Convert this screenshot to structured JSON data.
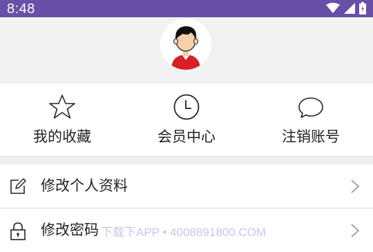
{
  "status_bar": {
    "time": "8:48",
    "icons": [
      "wifi-icon",
      "signal-icon",
      "battery-icon"
    ],
    "background": "#6a4fa8"
  },
  "profile": {
    "avatar_icon": "user-avatar-icon"
  },
  "quick_actions": [
    {
      "label": "我的收藏",
      "icon": "star-icon"
    },
    {
      "label": "会员中心",
      "icon": "clock-icon"
    },
    {
      "label": "注销账号",
      "icon": "chat-bubble-icon"
    }
  ],
  "menu": [
    {
      "label": "修改个人资料",
      "icon": "edit-icon"
    },
    {
      "label": "修改密码",
      "icon": "lock-icon"
    }
  ],
  "watermark": "下载下APP • 4008891800.COM"
}
